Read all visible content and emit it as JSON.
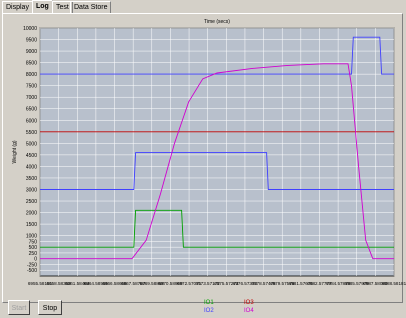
{
  "tabs": [
    {
      "label": "Display",
      "active": false
    },
    {
      "label": "Log",
      "active": true
    },
    {
      "label": "Test",
      "active": false
    },
    {
      "label": "Data Store",
      "active": false
    }
  ],
  "buttons": {
    "start_label": "Start",
    "stop_label": "Stop"
  },
  "legend": {
    "io1": "IO1",
    "io2": "IO2",
    "io3": "IO3",
    "io4": "IO4"
  },
  "colors": {
    "io1": "#00a000",
    "io2": "#4040ff",
    "io3": "#c00000",
    "io4": "#d000d0",
    "plot_bg": "#b8c0cc",
    "grid": "#ffffff"
  },
  "chart_data": {
    "type": "line",
    "ylabel": "Weight (g)",
    "xlabel": "Time (secs)",
    "ylim": [
      -750,
      10000
    ],
    "yticks": [
      "10000",
      "9500",
      "9000",
      "8500",
      "8000",
      "7500",
      "7000",
      "6500",
      "6000",
      "5500",
      "5000",
      "4500",
      "4000",
      "3500",
      "3000",
      "2500",
      "2000",
      "1500",
      "1000",
      "750",
      "500",
      "250",
      "0",
      "-250",
      "-500"
    ],
    "ytick_values": [
      10000,
      9500,
      9000,
      8500,
      8000,
      7500,
      7000,
      6500,
      6000,
      5500,
      5000,
      4500,
      4000,
      3500,
      3000,
      2500,
      2000,
      1500,
      1000,
      750,
      500,
      250,
      0,
      -250,
      -500
    ],
    "xticks": [
      "6955.58161",
      "6958.58363",
      "6961.58464",
      "6964.58565",
      "6966.58666",
      "6967.58767",
      "6969.58868",
      "6970.58969",
      "6972.57071",
      "6973.57172",
      "6975.57273",
      "6976.57374",
      "6978.57475",
      "6979.57576",
      "6981.57676",
      "6982.57777",
      "6984.57878",
      "6985.57979",
      "6987.58080",
      "6988.58181"
    ],
    "series": [
      {
        "key": "io1",
        "x": [
          0,
          0.265,
          0.27,
          0.4,
          0.405,
          1
        ],
        "y": [
          500,
          500,
          2100,
          2100,
          500,
          500
        ]
      },
      {
        "key": "io2",
        "x": [
          0,
          0.265,
          0.27,
          0.64,
          0.645,
          0.86,
          0.865,
          0.96,
          0.965,
          1
        ],
        "y": [
          3000,
          3000,
          4600,
          4600,
          3000,
          3000,
          3000,
          3000,
          3000,
          3000
        ]
      },
      {
        "key": "io2b",
        "x": [
          0,
          0.88,
          0.885,
          0.96,
          0.965,
          1
        ],
        "y": [
          8000,
          8000,
          9600,
          9600,
          8000,
          8000
        ]
      },
      {
        "key": "io3",
        "x": [
          0,
          1
        ],
        "y": [
          5500,
          5500
        ]
      },
      {
        "key": "io4",
        "x": [
          0,
          0.26,
          0.3,
          0.34,
          0.38,
          0.42,
          0.46,
          0.5,
          0.6,
          0.7,
          0.8,
          0.87,
          0.88,
          0.9,
          0.92,
          0.94,
          0.96,
          1
        ],
        "y": [
          0,
          0,
          800,
          2800,
          5000,
          6800,
          7800,
          8050,
          8250,
          8380,
          8450,
          8450,
          7500,
          4000,
          800,
          0,
          0,
          0
        ]
      }
    ]
  }
}
